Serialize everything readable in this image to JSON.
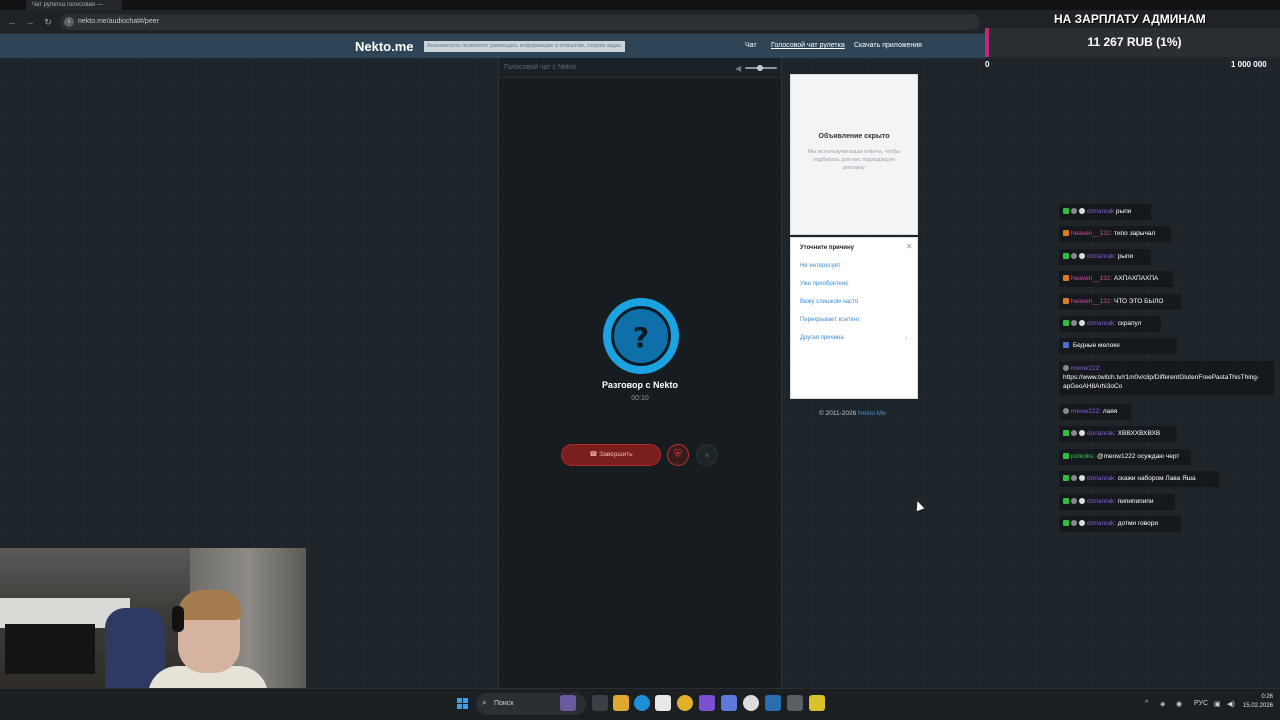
{
  "browser": {
    "tab_title": "Чат рулетка голосовая —",
    "url": "nekto.me/audiochat#/peer"
  },
  "header": {
    "logo": "Nekto.me",
    "notice": "Анонимность позволяет размещать информацию в открытом, скором задан",
    "nav": {
      "chat": "Чат",
      "voice_roulette": "Голосовой чат рулетка",
      "download": "Скачать приложения"
    }
  },
  "call": {
    "panel_title": "Голосовой чат с Nekto",
    "avatar_symbol": "?",
    "name": "Разговор с Nekto",
    "timer": "00:10",
    "end_label": "Завершить"
  },
  "ad": {
    "title": "Объявление скрыто",
    "text": "Мы используем ваши ответы, чтобы подбирать для вас подходящую рекламу"
  },
  "reason": {
    "title": "Уточните причину",
    "items": [
      "Не интересует",
      "Уже приобретено",
      "Вижу слишком часто",
      "Перекрывает контент",
      "Другая причина"
    ]
  },
  "footer": {
    "copyright": "© 2011-2026",
    "link": "Nekto.Me"
  },
  "donation": {
    "title": "НА ЗАРПЛАТУ АДМИНАМ",
    "amount": "11 267 RUB (1%)",
    "min": "0",
    "max": "1 000 000"
  },
  "chat": {
    "messages": [
      {
        "user": "dorianrak",
        "text": "рыпи",
        "badges": "green-grey-white",
        "color": "purple"
      },
      {
        "user": "heaven__132:",
        "text": "типо зарычал",
        "badges": "orange",
        "color": "pink"
      },
      {
        "user": "dorianrak:",
        "text": "рыпи",
        "badges": "green-grey-white",
        "color": "purple"
      },
      {
        "user": "heaven__132:",
        "text": "АХПАХПАХПА",
        "badges": "orange",
        "color": "pink"
      },
      {
        "user": "heaven__132:",
        "text": "ЧТО ЭТО БЫЛО",
        "badges": "orange",
        "color": "pink"
      },
      {
        "user": "dorianrak:",
        "text": "скрапул",
        "badges": "green-grey-white",
        "color": "purple"
      },
      {
        "user": "",
        "text": "Бедные мелоке",
        "badges": "blue",
        "color": "blue"
      },
      {
        "user": "meow222:",
        "text": "https://www.twitch.tv/r1m0v/clip/DifferentGlutenFreePastaThisThing-apGeoAH8Arhi3oCo",
        "badges": "grey",
        "color": "purple"
      },
      {
        "user": "meow222:",
        "text": "лаяя",
        "badges": "grey",
        "color": "purple"
      },
      {
        "user": "dorianrak:",
        "text": "ХВВХХВХВХВ",
        "badges": "green-grey-white",
        "color": "purple"
      },
      {
        "user": "poleoks:",
        "text": "@meow1222 осуждаю черт",
        "badges": "green",
        "color": "green"
      },
      {
        "user": "dorianrak:",
        "text": "скажи набором Лава Яша",
        "badges": "green-grey-white",
        "color": "purple"
      },
      {
        "user": "dorianrak:",
        "text": "пипипипипи",
        "badges": "green-grey-white",
        "color": "purple"
      },
      {
        "user": "dorianrak:",
        "text": "дотми говори",
        "badges": "green-grey-white",
        "color": "purple"
      }
    ]
  },
  "taskbar": {
    "search": "Поиск",
    "lang": "РУС",
    "time": "0:26",
    "date": "15.02.2026"
  }
}
